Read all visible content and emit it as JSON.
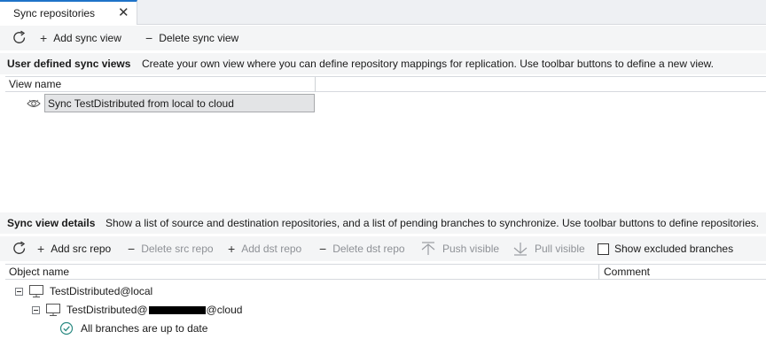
{
  "tab": {
    "label": "Sync repositories",
    "close_glyph": "✕"
  },
  "toolbar_top": {
    "refresh_icon": "refresh-icon",
    "add_label": "Add sync view",
    "delete_label": "Delete sync view"
  },
  "user_views": {
    "title": "User defined sync views",
    "description": "Create your own view where you can define repository mappings for replication. Use toolbar buttons to define a new view.",
    "column_header": "View name",
    "items": [
      {
        "label": "Sync TestDistributed from local to cloud",
        "icon": "eye-icon"
      }
    ]
  },
  "details": {
    "title": "Sync view details",
    "description": "Show a list of source and destination repositories, and a list of pending branches to synchronize. Use toolbar buttons to define repositories."
  },
  "toolbar_details": {
    "add_src": "Add src repo",
    "delete_src": "Delete src repo",
    "add_dst": "Add dst repo",
    "delete_dst": "Delete dst repo",
    "push_visible": "Push visible",
    "pull_visible": "Pull visible",
    "show_excluded": "Show excluded branches",
    "show_excluded_checked": false
  },
  "tree": {
    "columns": [
      "Object name",
      "Comment"
    ],
    "nodes": [
      {
        "label": "TestDistributed@local"
      },
      {
        "label_prefix": "TestDistributed@",
        "label_suffix": "@cloud"
      },
      {
        "label": "All branches are up to date"
      }
    ]
  },
  "colors": {
    "accent": "#1e73c8",
    "status_ok": "#2a8a82"
  }
}
